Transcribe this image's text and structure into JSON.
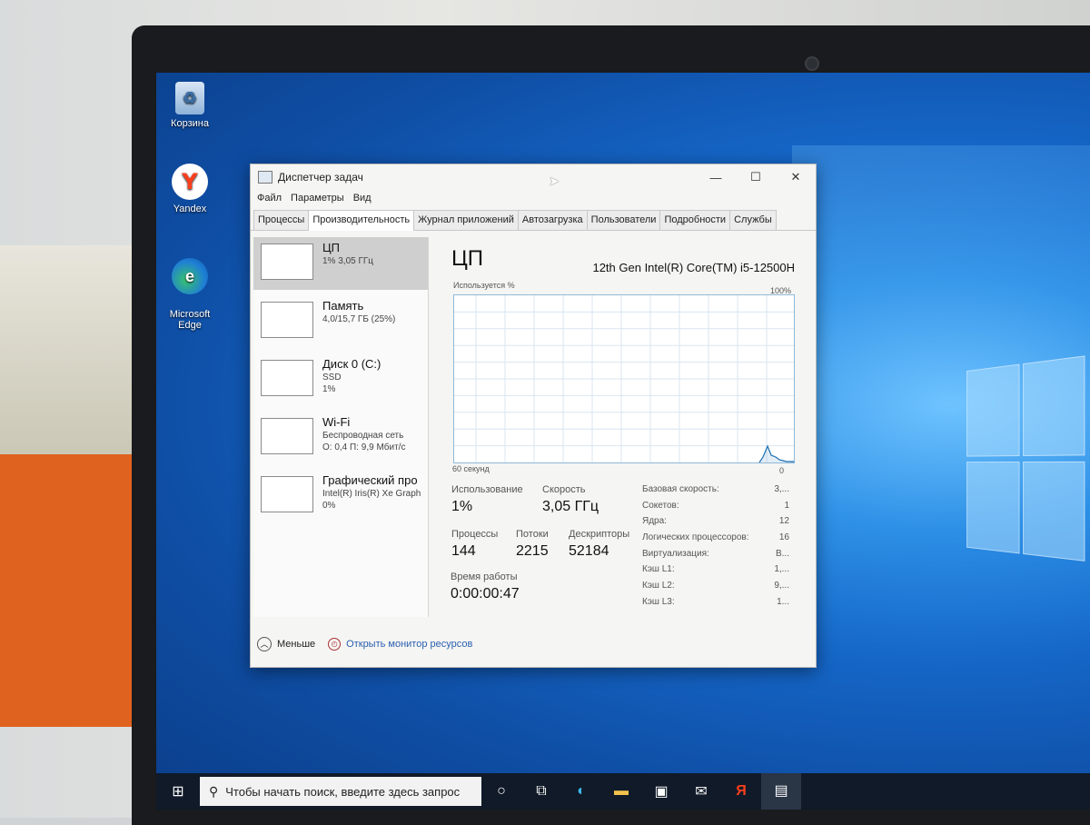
{
  "desktop": {
    "icons": [
      {
        "label": "Корзина",
        "glyph": "♻",
        "icon": "recycle-bin-icon"
      },
      {
        "label": "Yandex",
        "glyph": "Y",
        "icon": "yandex-browser-icon"
      },
      {
        "label": "Microsoft\nEdge",
        "glyph": "e",
        "icon": "edge-browser-icon"
      }
    ]
  },
  "window": {
    "title": "Диспетчер задач",
    "controls": {
      "minimize": "—",
      "maximize": "☐",
      "close": "✕"
    },
    "menu": [
      "Файл",
      "Параметры",
      "Вид"
    ],
    "tabs": [
      "Процессы",
      "Производительность",
      "Журнал приложений",
      "Автозагрузка",
      "Пользователи",
      "Подробности",
      "Службы"
    ],
    "active_tab": "Производительность"
  },
  "resources": [
    {
      "name": "ЦП",
      "sub1": "1% 3,05 ГГц",
      "sub2": ""
    },
    {
      "name": "Память",
      "sub1": "4,0/15,7 ГБ (25%)",
      "sub2": ""
    },
    {
      "name": "Диск 0 (C:)",
      "sub1": "SSD",
      "sub2": "1%"
    },
    {
      "name": "Wi-Fi",
      "sub1": "Беспроводная сеть",
      "sub2": "О: 0,4 П: 9,9 Мбит/с"
    },
    {
      "name": "Графический про",
      "sub1": "Intel(R) Iris(R) Xe Graph",
      "sub2": "0%"
    }
  ],
  "cpu": {
    "title": "ЦП",
    "model": "12th Gen Intel(R) Core(TM) i5-12500H",
    "graph_label": "Используется %",
    "graph_max": "100%",
    "graph_time": "60 секунд",
    "graph_min": "0",
    "usage_label": "Использование",
    "usage": "1%",
    "speed_label": "Скорость",
    "speed": "3,05 ГГц",
    "processes_label": "Процессы",
    "processes": "144",
    "threads_label": "Потоки",
    "threads": "2215",
    "handles_label": "Дескрипторы",
    "handles": "52184",
    "uptime_label": "Время работы",
    "uptime": "0:00:00:47",
    "specs": [
      {
        "label": "Базовая скорость:",
        "value": "3,..."
      },
      {
        "label": "Сокетов:",
        "value": "1"
      },
      {
        "label": "Ядра:",
        "value": "12"
      },
      {
        "label": "Логических процессоров:",
        "value": "16"
      },
      {
        "label": "Виртуализация:",
        "value": "В..."
      },
      {
        "label": "Кэш L1:",
        "value": "1,..."
      },
      {
        "label": "Кэш L2:",
        "value": "9,..."
      },
      {
        "label": "Кэш L3:",
        "value": "1..."
      }
    ]
  },
  "footer": {
    "less": "Меньше",
    "resmon": "Открыть монитор ресурсов"
  },
  "taskbar": {
    "start": "⊞",
    "search_placeholder": "Чтобы начать поиск, введите здесь запрос",
    "search_glyph": "⚲",
    "icons": [
      {
        "name": "cortana-icon",
        "glyph": "○"
      },
      {
        "name": "task-view-icon",
        "glyph": "⧉"
      },
      {
        "name": "edge-taskbar-icon",
        "glyph": "◐"
      },
      {
        "name": "file-explorer-icon",
        "glyph": "▬"
      },
      {
        "name": "store-icon",
        "glyph": "▣"
      },
      {
        "name": "mail-icon",
        "glyph": "✉"
      },
      {
        "name": "yandex-taskbar-icon",
        "glyph": "Я"
      },
      {
        "name": "task-manager-taskbar-icon",
        "glyph": "▤"
      }
    ]
  },
  "colors": {
    "accent": "#2a5fb0",
    "graph_line": "#1c6fb3",
    "desktop": "#1566c7"
  }
}
